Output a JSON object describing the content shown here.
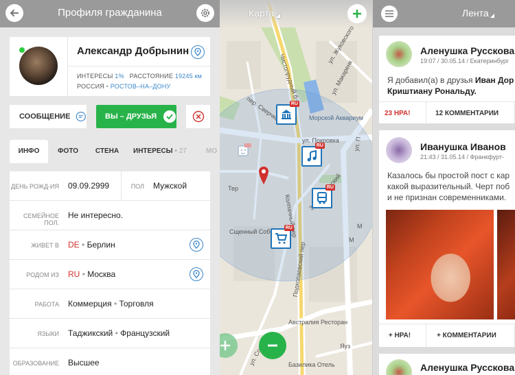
{
  "profile": {
    "header": {
      "title": "Профиля гражданина"
    },
    "user": {
      "name": "Александр Добрынин",
      "interests_label": "ИНТЕРЕСЫ",
      "interests_value": "1%",
      "distance_label": "РАССТОЯНИЕ",
      "distance_value": "19245 км",
      "country": "РОССИЯ",
      "city": "РОСТОВ–НА–ДОНУ"
    },
    "actions": {
      "message_label": "СООБЩЕНИЕ",
      "friends_label": "ВЫ – ДРУЗЬЯ"
    },
    "tabs": [
      {
        "label": "ИНФО"
      },
      {
        "label": "ФОТО"
      },
      {
        "label": "СТЕНА"
      },
      {
        "label": "ИНТЕРЕСЫ",
        "count": "27"
      },
      {
        "label": "МО"
      }
    ],
    "info": {
      "birthday_label": "ДЕНЬ РОЖД-ИЯ",
      "birthday_value": "09.09.2999",
      "sex_label": "ПОЛ",
      "sex_value": "Мужской",
      "family_label": "СЕМЕЙНОЕ ПОЛ.",
      "family_value": "Не интересно.",
      "lives_label": "ЖИВЕТ В",
      "lives_country": "DE",
      "lives_city": "Берлин",
      "born_label": "РОДОМ ИЗ",
      "born_country": "RU",
      "born_city": "Москва",
      "work_label": "РАБОТА",
      "work_value_1": "Коммерция",
      "work_value_2": "Торговля",
      "lang_label": "ЯЗЫКИ",
      "lang_value_1": "Таджикский",
      "lang_value_2": "Французский",
      "edu_label": "ОБРАЗОВАНИЕ",
      "edu_value": "Высшее"
    }
  },
  "map": {
    "header": {
      "title": "Карта"
    },
    "labels": {
      "street_zhukovsky": "ул. Жуковского",
      "chistoprudny": "Чистопрудный б-р",
      "street_makarenko": "ул. Макаренк",
      "morskoy": "Морской Аквариум",
      "street_sverchkov": "пер. Сверчков",
      "street_pokrovka": "ул. Покровка",
      "ul_p": "ул. П",
      "zlatoustinsky": "Златоустинский",
      "kolpachny": "Колпачный пер",
      "church": "Сщенный Собор",
      "cathedral": "Тер",
      "m1": "М",
      "m2": "М",
      "podkopaevsky": "Подкопаевский пер",
      "australia": "Австралия Ресторан",
      "yauz": "Яуз",
      "basilika": "Базилика Отель",
      "solyanka": "ул. Солянка"
    }
  },
  "feed": {
    "header": {
      "title": "Лента"
    },
    "posts": [
      {
        "author": "Аленушка Русскова",
        "meta": "19:07 / 30.05.14 / Екатеринбург",
        "text_1": "Я добавил(а) в друзья",
        "text_1_bold": "Иван Дор",
        "text_2_bold": "Криштиану Рональду.",
        "likes": "23 НРА!",
        "comments": "12 КОММЕНТАРИИ"
      },
      {
        "author": "Иванушка Иванов",
        "meta": "21:43 / 31.05.14 / Франкфурт-",
        "text_1": "Казалось бы простой пост с кар",
        "text_2": "какой выразительный. Черт поб",
        "text_3": "и не признан современниками.",
        "likes": "+ НРА!",
        "comments": "+ КОММЕНТАРИИ"
      },
      {
        "author": "Аленушка Русскова"
      }
    ]
  },
  "colors": {
    "green": "#28b34a",
    "blue": "#3a86c8",
    "red": "#d0312d"
  }
}
